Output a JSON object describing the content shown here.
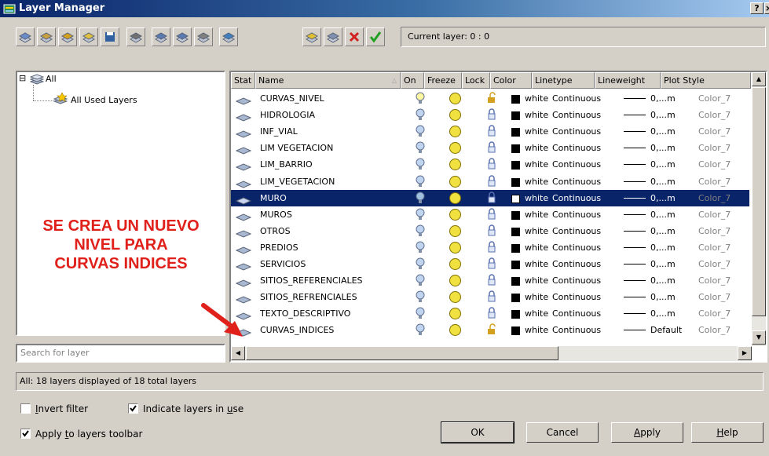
{
  "window": {
    "title": "Layer Manager",
    "help_button": "?",
    "close_button": "×"
  },
  "toolbar": {
    "buttons": [
      "new-properties-filter",
      "new-group-filter",
      "layer-states",
      "layer-settings",
      "save",
      "isolate-group",
      "layer-walk",
      "layer-translate",
      "match",
      "audit",
      "new-layer",
      "new-layer-vp-frozen",
      "delete-layer",
      "set-current"
    ],
    "current_layer": "Current layer: 0 : 0"
  },
  "tree": {
    "root": "All",
    "child": "All Used Layers",
    "expander": "⊟"
  },
  "search": {
    "placeholder": "Search for layer"
  },
  "grid": {
    "columns": [
      "Stat",
      "Name",
      "On",
      "Freeze",
      "Lock",
      "Color",
      "Linetype",
      "Lineweight",
      "Plot Style"
    ],
    "rows": [
      {
        "name": "CURVAS_NIVEL",
        "on": "on-bright",
        "lock": "unlocked",
        "color": "white",
        "linetype": "Continuous",
        "lineweight": "0,...m",
        "plotstyle": "Color_7",
        "selected": false
      },
      {
        "name": "HIDROLOGIA",
        "on": "on",
        "lock": "locked",
        "color": "white",
        "linetype": "Continuous",
        "lineweight": "0,...m",
        "plotstyle": "Color_7",
        "selected": false
      },
      {
        "name": "INF_VIAL",
        "on": "on",
        "lock": "locked",
        "color": "white",
        "linetype": "Continuous",
        "lineweight": "0,...m",
        "plotstyle": "Color_7",
        "selected": false
      },
      {
        "name": "LIM VEGETACION",
        "on": "on",
        "lock": "locked",
        "color": "white",
        "linetype": "Continuous",
        "lineweight": "0,...m",
        "plotstyle": "Color_7",
        "selected": false
      },
      {
        "name": "LIM_BARRIO",
        "on": "on",
        "lock": "locked",
        "color": "white",
        "linetype": "Continuous",
        "lineweight": "0,...m",
        "plotstyle": "Color_7",
        "selected": false
      },
      {
        "name": "LIM_VEGETACION",
        "on": "on",
        "lock": "locked",
        "color": "white",
        "linetype": "Continuous",
        "lineweight": "0,...m",
        "plotstyle": "Color_7",
        "selected": false
      },
      {
        "name": "MURO",
        "on": "on",
        "lock": "locked",
        "color": "white",
        "linetype": "Continuous",
        "lineweight": "0,...m",
        "plotstyle": "Color_7",
        "selected": true
      },
      {
        "name": "MUROS",
        "on": "on",
        "lock": "locked",
        "color": "white",
        "linetype": "Continuous",
        "lineweight": "0,...m",
        "plotstyle": "Color_7",
        "selected": false
      },
      {
        "name": "OTROS",
        "on": "on",
        "lock": "locked",
        "color": "white",
        "linetype": "Continuous",
        "lineweight": "0,...m",
        "plotstyle": "Color_7",
        "selected": false
      },
      {
        "name": "PREDIOS",
        "on": "on",
        "lock": "locked",
        "color": "white",
        "linetype": "Continuous",
        "lineweight": "0,...m",
        "plotstyle": "Color_7",
        "selected": false
      },
      {
        "name": "SERVICIOS",
        "on": "on",
        "lock": "locked",
        "color": "white",
        "linetype": "Continuous",
        "lineweight": "0,...m",
        "plotstyle": "Color_7",
        "selected": false
      },
      {
        "name": "SITIOS_REFERENCIALES",
        "on": "on",
        "lock": "locked",
        "color": "white",
        "linetype": "Continuous",
        "lineweight": "0,...m",
        "plotstyle": "Color_7",
        "selected": false
      },
      {
        "name": "SITIOS_REFRENCIALES",
        "on": "on",
        "lock": "locked",
        "color": "white",
        "linetype": "Continuous",
        "lineweight": "0,...m",
        "plotstyle": "Color_7",
        "selected": false
      },
      {
        "name": "TEXTO_DESCRIPTIVO",
        "on": "on",
        "lock": "locked",
        "color": "white",
        "linetype": "Continuous",
        "lineweight": "0,...m",
        "plotstyle": "Color_7",
        "selected": false
      },
      {
        "name": "CURVAS_INDICES",
        "on": "on",
        "lock": "unlocked",
        "color": "white",
        "linetype": "Continuous",
        "lineweight": "Default",
        "plotstyle": "Color_7",
        "selected": false
      }
    ]
  },
  "status": {
    "text": "All: 18 layers displayed of 18 total layers"
  },
  "options": {
    "invert_filter": {
      "label": "Invert filter",
      "checked": false
    },
    "indicate_in_use": {
      "label": "Indicate layers in use",
      "checked": true
    },
    "apply_to_toolbar": {
      "label": "Apply to layers toolbar",
      "checked": true
    }
  },
  "buttons": {
    "ok": "OK",
    "cancel": "Cancel",
    "apply": "Apply",
    "help": "Help"
  },
  "annotation": {
    "line1": "SE CREA UN NUEVO",
    "line2": "NIVEL PARA",
    "line3": "CURVAS INDICES",
    "color": "#e0201a"
  }
}
